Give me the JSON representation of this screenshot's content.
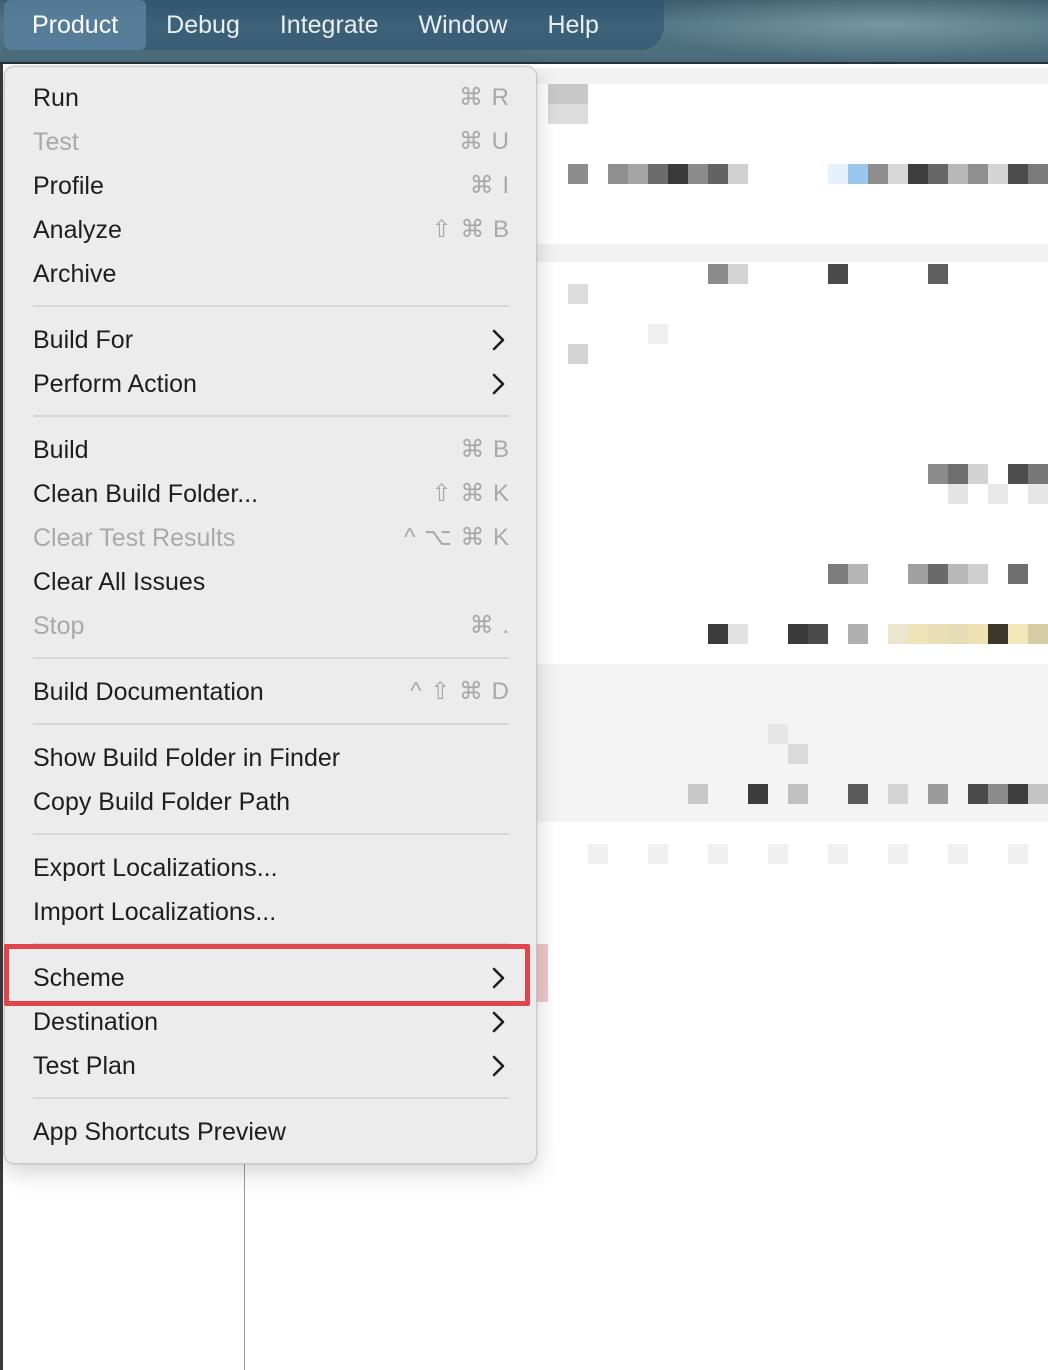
{
  "menubar": {
    "items": [
      {
        "label": "Product",
        "active": true
      },
      {
        "label": "Debug"
      },
      {
        "label": "Integrate"
      },
      {
        "label": "Window"
      },
      {
        "label": "Help"
      }
    ]
  },
  "product_menu": {
    "groups": [
      [
        {
          "label": "Run",
          "shortcut": "⌘ R",
          "enabled": true
        },
        {
          "label": "Test",
          "shortcut": "⌘ U",
          "enabled": false
        },
        {
          "label": "Profile",
          "shortcut": "⌘ I",
          "enabled": true
        },
        {
          "label": "Analyze",
          "shortcut": "⇧ ⌘ B",
          "enabled": true
        },
        {
          "label": "Archive",
          "shortcut": "",
          "enabled": true
        }
      ],
      [
        {
          "label": "Build For",
          "submenu": true,
          "enabled": true
        },
        {
          "label": "Perform Action",
          "submenu": true,
          "enabled": true
        }
      ],
      [
        {
          "label": "Build",
          "shortcut": "⌘ B",
          "enabled": true
        },
        {
          "label": "Clean Build Folder...",
          "shortcut": "⇧ ⌘ K",
          "enabled": true
        },
        {
          "label": "Clear Test Results",
          "shortcut": "^ ⌥ ⌘ K",
          "enabled": false
        },
        {
          "label": "Clear All Issues",
          "shortcut": "",
          "enabled": true
        },
        {
          "label": "Stop",
          "shortcut": "⌘ .",
          "enabled": false
        }
      ],
      [
        {
          "label": "Build Documentation",
          "shortcut": "^ ⇧ ⌘ D",
          "enabled": true
        }
      ],
      [
        {
          "label": "Show Build Folder in Finder",
          "shortcut": "",
          "enabled": true
        },
        {
          "label": "Copy Build Folder Path",
          "shortcut": "",
          "enabled": true
        }
      ],
      [
        {
          "label": "Export Localizations...",
          "shortcut": "",
          "enabled": true
        },
        {
          "label": "Import Localizations...",
          "shortcut": "",
          "enabled": true
        }
      ],
      [
        {
          "label": "Scheme",
          "submenu": true,
          "enabled": true,
          "highlighted": true
        },
        {
          "label": "Destination",
          "submenu": true,
          "enabled": true
        },
        {
          "label": "Test Plan",
          "submenu": true,
          "enabled": true
        }
      ],
      [
        {
          "label": "App Shortcuts Preview",
          "shortcut": "",
          "enabled": true
        }
      ]
    ]
  },
  "colors": {
    "highlight_border": "#e0454b",
    "menu_background": "#ececec",
    "disabled_text": "#a9a9a9"
  }
}
